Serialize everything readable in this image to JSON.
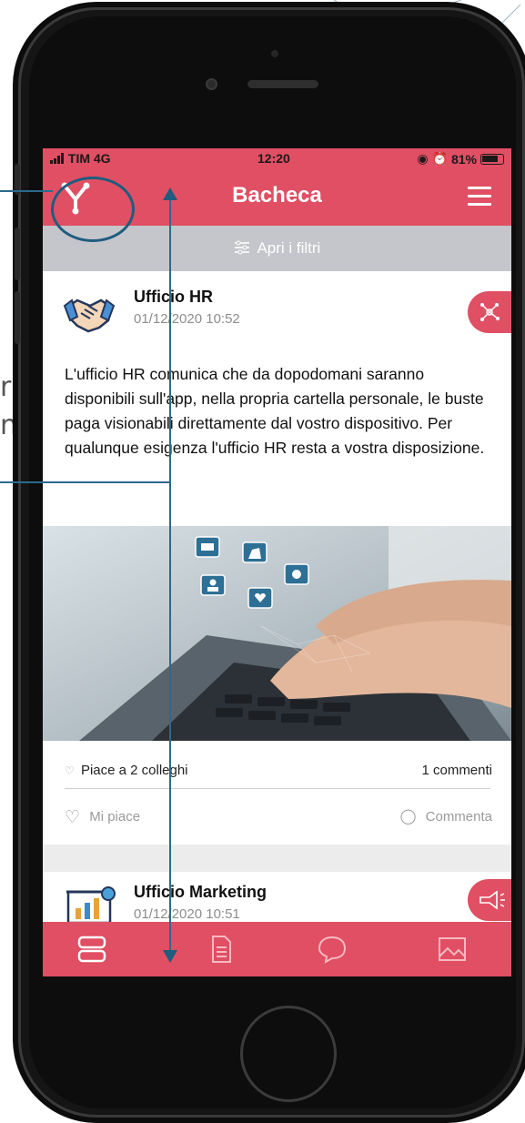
{
  "status_bar": {
    "carrier": "TIM 4G",
    "time": "12:20",
    "battery": "81%"
  },
  "header": {
    "title": "Bacheca"
  },
  "filters": {
    "label": "Apri i filtri"
  },
  "posts": [
    {
      "author": "Ufficio HR",
      "date": "01/12/2020 10:52",
      "body": "L'ufficio HR comunica che da dopodomani saranno disponibili sull'app, nella propria cartella personale, le buste paga visionabili direttamente dal vostro dispositivo. Per qualunque esigenza l'ufficio HR resta a vostra disposizione.",
      "likes_text": "Piace a 2 colleghi",
      "comments_text": "1 commenti",
      "like_action": "Mi piace",
      "comment_action": "Commenta"
    },
    {
      "author": "Ufficio Marketing",
      "date": "01/12/2020 10:51"
    }
  ],
  "side_fragments": {
    "frag1": "r",
    "frag2": "ne"
  },
  "icons": {
    "logo": "y-logo-icon",
    "menu": "hamburger-icon",
    "filters": "sliders-icon",
    "hr_avatar": "handshake-icon",
    "hr_badge": "network-icon",
    "marketing_avatar": "presentation-chart-icon",
    "marketing_badge": "megaphone-icon",
    "tabs": [
      "feed-icon",
      "document-icon",
      "chat-icon",
      "gallery-icon"
    ]
  },
  "colors": {
    "brand": "#e04f63",
    "filter_bar": "#c5c6cb",
    "annotation": "#1f5c7e"
  }
}
